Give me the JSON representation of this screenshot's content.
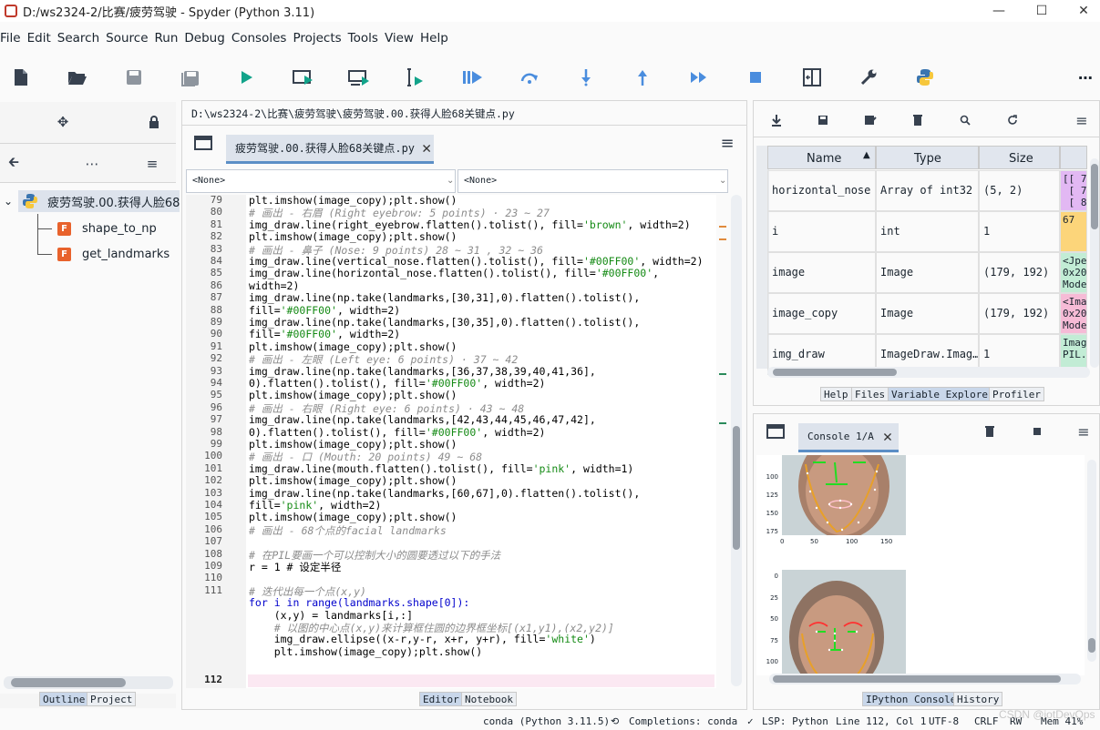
{
  "window": {
    "title": "D:/ws2324-2/比赛/疲劳驾驶 - Spyder (Python 3.11)",
    "minimize": "—",
    "maximize": "☐",
    "close": "✕"
  },
  "menu": [
    "File",
    "Edit",
    "Search",
    "Source",
    "Run",
    "Debug",
    "Consoles",
    "Projects",
    "Tools",
    "View",
    "Help"
  ],
  "toolbar": {
    "icons": [
      "new-file-icon",
      "open-file-icon",
      "save-icon",
      "save-all-icon",
      "run-icon",
      "run-cell-icon",
      "run-cell-advance-icon",
      "run-selection-icon",
      "debug-icon",
      "step-over-icon",
      "step-into-icon",
      "step-return-icon",
      "continue-icon",
      "stop-icon",
      "maximize-pane-icon",
      "preferences-icon",
      "python-path-icon",
      "more-icon"
    ]
  },
  "outline": {
    "root": "疲劳驾驶.00.获得人脸68",
    "items": [
      "shape_to_np",
      "get_landmarks"
    ],
    "bottom_tabs": [
      "Outline",
      "Project"
    ]
  },
  "editor": {
    "path": "D:\\ws2324-2\\比赛\\疲劳驾驶\\疲劳驾驶.00.获得人脸68关键点.py",
    "tab": "疲劳驾驶.00.获得人脸68关键点.py",
    "combo_left": "<None>",
    "combo_right": "<None>",
    "current_line": "112",
    "bottom_tabs": [
      "Editor",
      "Notebook"
    ]
  },
  "varexp": {
    "headers": [
      "Name",
      "Type",
      "Size"
    ],
    "rows": [
      {
        "name": "horizontal_nose",
        "type": "Array of int32",
        "size": "(5, 2)",
        "value": "[[ 7\n [ 7\n [ 8",
        "color": "#e2b8f3"
      },
      {
        "name": "i",
        "type": "int",
        "size": "1",
        "value": "67",
        "color": "#fcd57a"
      },
      {
        "name": "image",
        "type": "Image",
        "size": "(179, 192)",
        "value": "<Jpe\n0x20\nMode",
        "color": "#c2ecd5"
      },
      {
        "name": "image_copy",
        "type": "Image",
        "size": "(179, 192)",
        "value": "<Ima\n0x20\nMode",
        "color": "#f6bbd6"
      },
      {
        "name": "img_draw",
        "type": "ImageDraw.Imag…",
        "size": "1",
        "value": "Imag\nPIL.",
        "color": "#c2ecd5"
      }
    ],
    "tabs": [
      "Help",
      "Files",
      "Variable Explorer",
      "Profiler"
    ]
  },
  "console": {
    "tab": "Console 1/A",
    "bottom_tabs": [
      "IPython Console",
      "History"
    ],
    "plot1_yticks": [
      "100",
      "125",
      "150",
      "175"
    ],
    "plot1_xticks": [
      "0",
      "50",
      "100",
      "150"
    ],
    "plot2_yticks": [
      "0",
      "25",
      "50",
      "75",
      "100",
      "125"
    ]
  },
  "status": {
    "env": "conda (Python 3.11.5)",
    "completions": "Completions: conda",
    "lsp": "LSP: Python",
    "position": "Line 112, Col 1",
    "encoding": "UTF-8",
    "eol": "CRLF",
    "rw": "RW",
    "mem": "Mem 41%",
    "watermark": "CSDN @iotDevOps"
  },
  "code_lines": [
    {
      "n": "79",
      "t": "plt.imshow(image_copy);plt.show()",
      "k": ""
    },
    {
      "n": "80",
      "t": "# 画出 - 右眉 (Right eyebrow: 5 points) · 23 ~ 27",
      "k": "cm"
    },
    {
      "n": "81",
      "t": "img_draw.line(right_eyebrow.flatten().tolist(), fill='brown', width=2)",
      "k": ""
    },
    {
      "n": "82",
      "t": "plt.imshow(image_copy);plt.show()",
      "k": ""
    },
    {
      "n": "83",
      "t": "# 画出 - 鼻子 (Nose: 9 points) 28 ~ 31 , 32 ~ 36",
      "k": "cm"
    },
    {
      "n": "84",
      "t": "img_draw.line(vertical_nose.flatten().tolist(), fill='#00FF00', width=2)",
      "k": ""
    },
    {
      "n": "85",
      "t": "img_draw.line(horizontal_nose.flatten().tolist(), fill='#00FF00',",
      "k": ""
    },
    {
      "n": "86",
      "t": "width=2)",
      "k": ""
    },
    {
      "n": "87",
      "t": "img_draw.line(np.take(landmarks,[30,31],0).flatten().tolist(),",
      "k": ""
    },
    {
      "n": "88",
      "t": "fill='#00FF00', width=2)",
      "k": ""
    },
    {
      "n": "89",
      "t": "img_draw.line(np.take(landmarks,[30,35],0).flatten().tolist(),",
      "k": ""
    },
    {
      "n": "90",
      "t": "fill='#00FF00', width=2)",
      "k": ""
    },
    {
      "n": "91",
      "t": "plt.imshow(image_copy);plt.show()",
      "k": ""
    },
    {
      "n": "92",
      "t": "# 画出 - 左眼 (Left eye: 6 points) · 37 ~ 42",
      "k": "cm"
    },
    {
      "n": "93",
      "t": "img_draw.line(np.take(landmarks,[36,37,38,39,40,41,36],",
      "k": ""
    },
    {
      "n": "94",
      "t": "0).flatten().tolist(), fill='#00FF00', width=2)",
      "k": ""
    },
    {
      "n": "95",
      "t": "plt.imshow(image_copy);plt.show()",
      "k": ""
    },
    {
      "n": "96",
      "t": "# 画出 - 右眼 (Right eye: 6 points) · 43 ~ 48",
      "k": "cm"
    },
    {
      "n": "97",
      "t": "img_draw.line(np.take(landmarks,[42,43,44,45,46,47,42],",
      "k": ""
    },
    {
      "n": "98",
      "t": "0).flatten().tolist(), fill='#00FF00', width=2)",
      "k": ""
    },
    {
      "n": "99",
      "t": "plt.imshow(image_copy);plt.show()",
      "k": ""
    },
    {
      "n": "100",
      "t": "# 画出 - 口 (Mouth: 20 points) 49 ~ 68",
      "k": "cm"
    },
    {
      "n": "101",
      "t": "img_draw.line(mouth.flatten().tolist(), fill='pink', width=1)",
      "k": ""
    },
    {
      "n": "102",
      "t": "plt.imshow(image_copy);plt.show()",
      "k": ""
    },
    {
      "n": "103",
      "t": "img_draw.line(np.take(landmarks,[60,67],0).flatten().tolist(),",
      "k": ""
    },
    {
      "n": "104",
      "t": "fill='pink', width=2)",
      "k": ""
    },
    {
      "n": "105",
      "t": "plt.imshow(image_copy);plt.show()",
      "k": ""
    },
    {
      "n": "106",
      "t": "# 画出 - 68个点的facial landmarks",
      "k": "cm"
    },
    {
      "n": "107",
      "t": "",
      "k": ""
    },
    {
      "n": "108",
      "t": "# 在PIL要画一个可以控制大小的圆要透过以下的手法",
      "k": "cm"
    },
    {
      "n": "109",
      "t": "r = 1 # 设定半径",
      "k": ""
    },
    {
      "n": "110",
      "t": "",
      "k": ""
    },
    {
      "n": "111",
      "t": "# 迭代出每一个点(x,y)",
      "k": "cm"
    },
    {
      "n": "112",
      "t": "for i in range(landmarks.shape[0]):",
      "k": "kw"
    },
    {
      "n": "",
      "t": "    (x,y) = landmarks[i,:]",
      "k": ""
    },
    {
      "n": "",
      "t": "    # 以图的中心点(x,y)来计算框住圆的边界框坐标[(x1,y1),(x2,y2)]",
      "k": "cm"
    },
    {
      "n": "",
      "t": "    img_draw.ellipse((x-r,y-r, x+r, y+r), fill='white')",
      "k": ""
    },
    {
      "n": "",
      "t": "    plt.imshow(image_copy);plt.show()",
      "k": ""
    }
  ]
}
